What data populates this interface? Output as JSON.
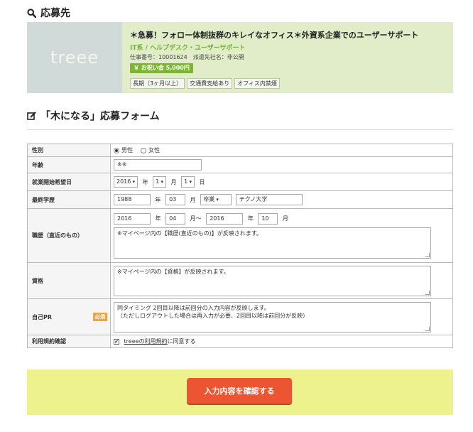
{
  "apply_section": {
    "title": "応募先"
  },
  "job": {
    "logo_text": "treee",
    "title": "＊急募！フォロー体制抜群のキレイなオフィス＊外資系企業でのユーザーサポート",
    "category": "IT系 / ヘルプデスク・ユーザーサポート",
    "meta": "仕事番号：10001624　派遣先社名：非公開",
    "bonus": "￥ お祝い金 5,000円",
    "tags": [
      "長期（3ヶ月以上）",
      "交通費支給あり",
      "オフィス内禁煙"
    ]
  },
  "form_section": {
    "title": "「木になる」応募フォーム"
  },
  "form": {
    "gender": {
      "label": "性別",
      "options": [
        "男性",
        "女性"
      ]
    },
    "age": {
      "label": "年齢",
      "value": "※※"
    },
    "start_date": {
      "label": "就業開始希望日",
      "year": "2016",
      "year_unit": "年",
      "month": "1",
      "month_unit": "月",
      "day": "1",
      "day_unit": "日"
    },
    "education": {
      "label": "最終学歴",
      "year": "1988",
      "year_unit": "年",
      "month": "03",
      "month_unit": "月",
      "status": "卒業",
      "school": "テクノ大学"
    },
    "career": {
      "label": "職歴（直近のもの）",
      "from_year": "2016",
      "from_year_unit": "年",
      "from_month": "04",
      "from_month_unit": "月～",
      "to_year": "2016",
      "to_year_unit": "年",
      "to_month": "10",
      "to_month_unit": "月",
      "text": "※マイページ内の【職歴(直近のもの)】が反映されます。"
    },
    "qualification": {
      "label": "資格",
      "text": "※マイページ内の【資格】が反映されます。"
    },
    "pr": {
      "label": "自己PR",
      "badge": "必須",
      "text": "同タイミング 2回目以降は前回分の入力内容が反映します。\n（ただしログアウトした場合は再入力が必要、2回目以降は前回分が反映）"
    },
    "terms": {
      "label": "利用規約確認",
      "check_mark": "✔",
      "link_text": "treeeの利用規約",
      "suffix": "に同意する"
    }
  },
  "submit": {
    "label": "入力内容を確認する"
  }
}
